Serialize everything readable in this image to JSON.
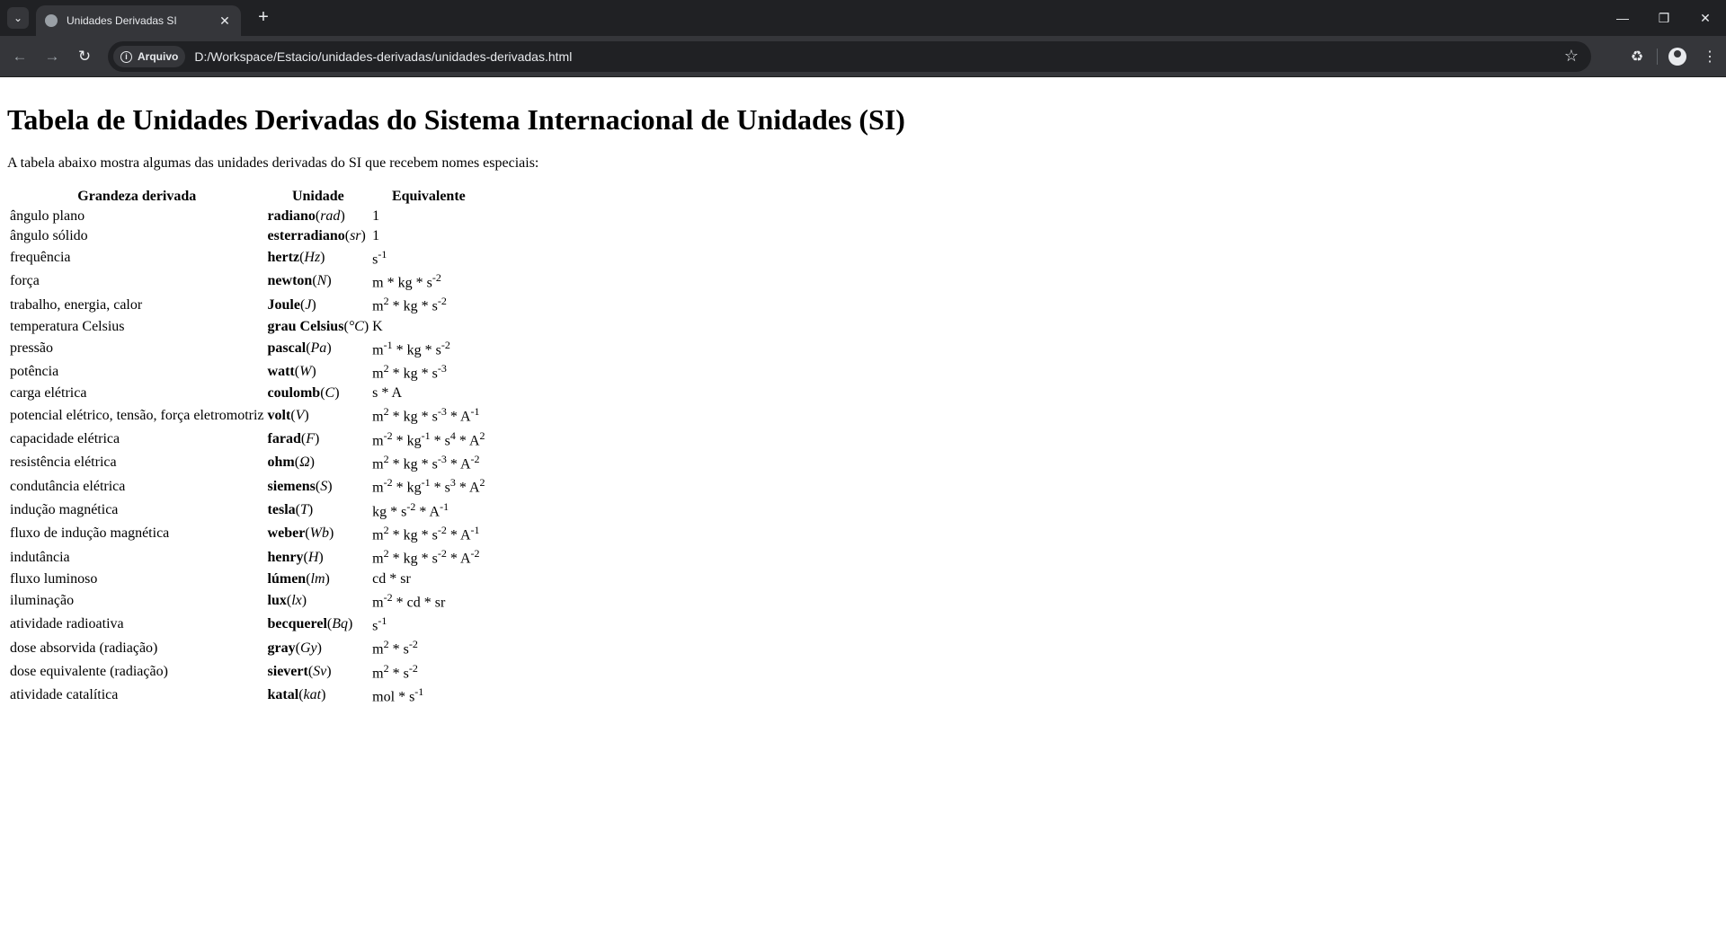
{
  "browser": {
    "tab_title": "Unidades Derivadas SI",
    "security_label": "Arquivo",
    "url": "D:/Workspace/Estacio/unidades-derivadas/unidades-derivadas.html"
  },
  "page": {
    "heading": "Tabela de Unidades Derivadas do Sistema Internacional de Unidades (SI)",
    "intro": "A tabela abaixo mostra algumas das unidades derivadas do SI que recebem nomes especiais:",
    "columns": [
      "Grandeza derivada",
      "Unidade",
      "Equivalente"
    ],
    "rows": [
      {
        "grandeza": "ângulo plano",
        "unit": "radiano",
        "symbol": "rad",
        "equiv": [
          [
            "1",
            ""
          ]
        ]
      },
      {
        "grandeza": "ângulo sólido",
        "unit": "esterradiano",
        "symbol": "sr",
        "equiv": [
          [
            "1",
            ""
          ]
        ]
      },
      {
        "grandeza": "frequência",
        "unit": "hertz",
        "symbol": "Hz",
        "equiv": [
          [
            "s",
            "-1"
          ]
        ]
      },
      {
        "grandeza": "força",
        "unit": "newton",
        "symbol": "N",
        "equiv": [
          [
            "m",
            ""
          ],
          [
            "kg",
            ""
          ],
          [
            "s",
            "-2"
          ]
        ]
      },
      {
        "grandeza": "trabalho, energia, calor",
        "unit": "Joule",
        "symbol": "J",
        "equiv": [
          [
            "m",
            "2"
          ],
          [
            "kg",
            ""
          ],
          [
            "s",
            "-2"
          ]
        ]
      },
      {
        "grandeza": "temperatura Celsius",
        "unit": "grau Celsius",
        "symbol": "°C",
        "equiv": [
          [
            "K",
            ""
          ]
        ]
      },
      {
        "grandeza": "pressão",
        "unit": "pascal",
        "symbol": "Pa",
        "equiv": [
          [
            "m",
            "-1"
          ],
          [
            "kg",
            ""
          ],
          [
            "s",
            "-2"
          ]
        ]
      },
      {
        "grandeza": "potência",
        "unit": "watt",
        "symbol": "W",
        "equiv": [
          [
            "m",
            "2"
          ],
          [
            "kg",
            ""
          ],
          [
            "s",
            "-3"
          ]
        ]
      },
      {
        "grandeza": "carga elétrica",
        "unit": "coulomb",
        "symbol": "C",
        "equiv": [
          [
            "s",
            ""
          ],
          [
            "A",
            ""
          ]
        ]
      },
      {
        "grandeza": "potencial elétrico, tensão, força eletromotriz",
        "unit": "volt",
        "symbol": "V",
        "equiv": [
          [
            "m",
            "2"
          ],
          [
            "kg",
            ""
          ],
          [
            "s",
            "-3"
          ],
          [
            "A",
            "-1"
          ]
        ]
      },
      {
        "grandeza": "capacidade elétrica",
        "unit": "farad",
        "symbol": "F",
        "equiv": [
          [
            "m",
            "-2"
          ],
          [
            "kg",
            "-1"
          ],
          [
            "s",
            "4"
          ],
          [
            "A",
            "2"
          ]
        ]
      },
      {
        "grandeza": "resistência elétrica",
        "unit": "ohm",
        "symbol": "Ω",
        "equiv": [
          [
            "m",
            "2"
          ],
          [
            "kg",
            ""
          ],
          [
            "s",
            "-3"
          ],
          [
            "A",
            "-2"
          ]
        ]
      },
      {
        "grandeza": "condutância elétrica",
        "unit": "siemens",
        "symbol": "S",
        "equiv": [
          [
            "m",
            "-2"
          ],
          [
            "kg",
            "-1"
          ],
          [
            "s",
            "3"
          ],
          [
            "A",
            "2"
          ]
        ]
      },
      {
        "grandeza": "indução magnética",
        "unit": "tesla",
        "symbol": "T",
        "equiv": [
          [
            "kg",
            ""
          ],
          [
            "s",
            "-2"
          ],
          [
            "A",
            "-1"
          ]
        ]
      },
      {
        "grandeza": "fluxo de indução magnética",
        "unit": "weber",
        "symbol": "Wb",
        "equiv": [
          [
            "m",
            "2"
          ],
          [
            "kg",
            ""
          ],
          [
            "s",
            "-2"
          ],
          [
            "A",
            "-1"
          ]
        ]
      },
      {
        "grandeza": "indutância",
        "unit": "henry",
        "symbol": "H",
        "equiv": [
          [
            "m",
            "2"
          ],
          [
            "kg",
            ""
          ],
          [
            "s",
            "-2"
          ],
          [
            "A",
            "-2"
          ]
        ]
      },
      {
        "grandeza": "fluxo luminoso",
        "unit": "lúmen",
        "symbol": "lm",
        "equiv": [
          [
            "cd",
            ""
          ],
          [
            "sr",
            ""
          ]
        ]
      },
      {
        "grandeza": "iluminação",
        "unit": "lux",
        "symbol": "lx",
        "equiv": [
          [
            "m",
            "-2"
          ],
          [
            "cd",
            ""
          ],
          [
            "sr",
            ""
          ]
        ]
      },
      {
        "grandeza": "atividade radioativa",
        "unit": "becquerel",
        "symbol": "Bq",
        "equiv": [
          [
            "s",
            "-1"
          ]
        ]
      },
      {
        "grandeza": "dose absorvida (radiação)",
        "unit": "gray",
        "symbol": "Gy",
        "equiv": [
          [
            "m",
            "2"
          ],
          [
            "s",
            "-2"
          ]
        ]
      },
      {
        "grandeza": "dose equivalente (radiação)",
        "unit": "sievert",
        "symbol": "Sv",
        "equiv": [
          [
            "m",
            "2"
          ],
          [
            "s",
            "-2"
          ]
        ]
      },
      {
        "grandeza": "atividade catalítica",
        "unit": "katal",
        "symbol": "kat",
        "equiv": [
          [
            "mol",
            ""
          ],
          [
            "s",
            "-1"
          ]
        ]
      }
    ]
  }
}
